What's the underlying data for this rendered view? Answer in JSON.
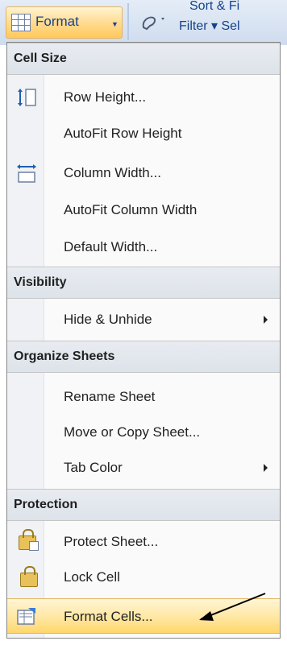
{
  "ribbon": {
    "format_label": "Format",
    "sort_label": "Sort & Fi",
    "filter_label": "Filter ▾ Sel"
  },
  "menu": {
    "cell_size": {
      "header": "Cell Size",
      "items": [
        "Row Height...",
        "AutoFit Row Height",
        "Column Width...",
        "AutoFit Column Width",
        "Default Width..."
      ]
    },
    "visibility": {
      "header": "Visibility",
      "items": [
        "Hide & Unhide"
      ]
    },
    "organize": {
      "header": "Organize Sheets",
      "items": [
        "Rename Sheet",
        "Move or Copy Sheet...",
        "Tab Color"
      ]
    },
    "protection": {
      "header": "Protection",
      "items": [
        "Protect Sheet...",
        "Lock Cell",
        "Format Cells..."
      ]
    }
  },
  "colors": {
    "highlight": "#ffd66b",
    "header_bg": "#dde3ea",
    "ribbon_text": "#15428b"
  }
}
